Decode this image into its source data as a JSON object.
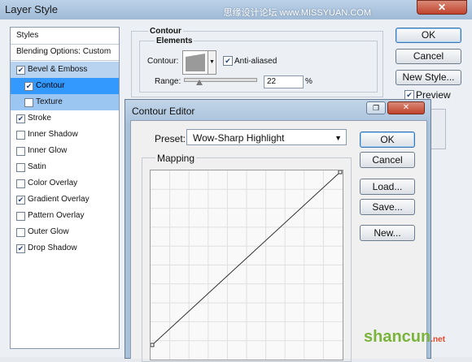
{
  "window": {
    "title": "Layer Style",
    "watermark_top": "思缘设计论坛 www.MISSYUAN.COM",
    "close_glyph": "✕"
  },
  "styles_list": {
    "items": [
      {
        "label": "Styles",
        "checkbox": false,
        "checked": false
      },
      {
        "label": "Blending Options: Custom",
        "checkbox": false,
        "checked": false
      },
      {
        "label": "Bevel & Emboss",
        "checkbox": true,
        "checked": true
      },
      {
        "label": "Contour",
        "checkbox": true,
        "checked": true
      },
      {
        "label": "Texture",
        "checkbox": true,
        "checked": false
      },
      {
        "label": "Stroke",
        "checkbox": true,
        "checked": true
      },
      {
        "label": "Inner Shadow",
        "checkbox": true,
        "checked": false
      },
      {
        "label": "Inner Glow",
        "checkbox": true,
        "checked": false
      },
      {
        "label": "Satin",
        "checkbox": true,
        "checked": false
      },
      {
        "label": "Color Overlay",
        "checkbox": true,
        "checked": false
      },
      {
        "label": "Gradient Overlay",
        "checkbox": true,
        "checked": true
      },
      {
        "label": "Pattern Overlay",
        "checkbox": true,
        "checked": false
      },
      {
        "label": "Outer Glow",
        "checkbox": true,
        "checked": false
      },
      {
        "label": "Drop Shadow",
        "checkbox": true,
        "checked": true
      }
    ]
  },
  "contour_panel": {
    "heading": "Contour",
    "elements_label": "Elements",
    "contour_label": "Contour:",
    "anti_aliased_label": "Anti-aliased",
    "anti_aliased_checked": true,
    "range_label": "Range:",
    "range_value": "22",
    "range_unit": "%"
  },
  "buttons": {
    "ok": "OK",
    "cancel": "Cancel",
    "new_style": "New Style...",
    "preview": "Preview",
    "preview_checked": true
  },
  "contour_editor": {
    "title": "Contour Editor",
    "preset_label": "Preset:",
    "preset_value": "Wow-Sharp Highlight",
    "mapping_label": "Mapping",
    "ok": "OK",
    "cancel": "Cancel",
    "load": "Load...",
    "save": "Save...",
    "new": "New..."
  },
  "watermark": {
    "text": "shancun",
    "suffix": ".net"
  },
  "colors": {
    "selection_blue": "#3399ff",
    "light_selection": "#b7d3f0",
    "watermark_green": "#7ab43a"
  }
}
